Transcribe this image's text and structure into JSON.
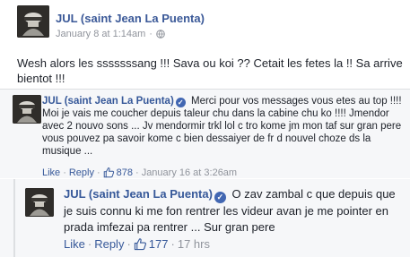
{
  "post": {
    "author": "JUL (saint Jean La Puenta)",
    "date": "January 8 at 1:14am",
    "separator": "·",
    "text": "Wesh alors les sssssssang !!! Sava ou koi ?? Cetait les fetes la !! Sa arrive bientot !!!"
  },
  "comments": [
    {
      "author": "JUL (saint Jean La Puenta)",
      "text": "Merci pour vos messages vous etes au top !!!! Moi je vais me coucher depuis taleur chu dans la cabine chu ko !!!! Jmendor avec 2 nouvo sons ... Jv mendormir trkl lol c tro kome jm mon taf sur gran pere vous pouvez pa savoir kome c bien dessaiyer de fr d nouvel choze ds la musique ...",
      "like_label": "Like",
      "reply_label": "Reply",
      "likes": "878",
      "time": "January 16 at 3:26am"
    },
    {
      "author": "JUL (saint Jean La Puenta)",
      "text": "O zav zambal c que depuis que je suis connu ki me fon rentrer les videur avan je me pointer en prada imfezai pa rentrer ... Sur gran pere",
      "like_label": "Like",
      "reply_label": "Reply",
      "likes": "177",
      "time": "17 hrs"
    }
  ],
  "colors": {
    "link": "#365899",
    "meta": "#90949c",
    "comment_bg": "#f6f7f9",
    "verified": "#4267b2"
  },
  "icons": [
    "avatar-image",
    "globe-icon",
    "verified-badge-icon",
    "thumbs-up-icon"
  ]
}
